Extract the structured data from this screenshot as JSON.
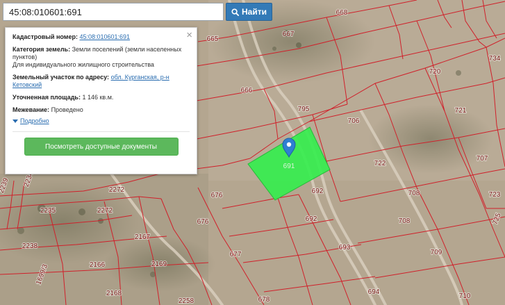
{
  "search": {
    "value": "45:08:010601:691",
    "button_label": "Найти"
  },
  "info": {
    "cadastral_label": "Кадастровый номер:",
    "cadastral_value": "45:08:010601:691",
    "category_label": "Категория земель:",
    "category_value": "Земли поселений (земли населенных пунктов)",
    "use_value": "Для индивидуального жилищного строительства",
    "address_label": "Земельный участок по адресу:",
    "address_value": "обл. Курганская, р-н Кетовский",
    "area_label": "Уточненная площадь:",
    "area_value": "1 146 кв.м.",
    "survey_label": "Межевание:",
    "survey_value": "Проведено",
    "more_label": "Подробно",
    "docs_button": "Посмотреть доступные документы",
    "close_symbol": "×"
  },
  "map": {
    "selected_parcel_label": "691",
    "parcel_labels": [
      "668",
      "665",
      "667",
      "720",
      "734",
      "666",
      "795",
      "721",
      "706",
      "722",
      "707",
      "723",
      "708",
      "2272",
      "2234",
      "2239",
      "2272",
      "2235",
      "676",
      "692",
      "692",
      "676",
      "708",
      "725",
      "2238",
      "2167",
      "693",
      "709",
      "677",
      "2166",
      "2169",
      "1699/3",
      "2168",
      "2258",
      "678",
      "694",
      "710"
    ],
    "colors": {
      "boundary": "#d0202a",
      "selected_fill": "#33ee4c",
      "marker": "#2f7fd1"
    }
  }
}
